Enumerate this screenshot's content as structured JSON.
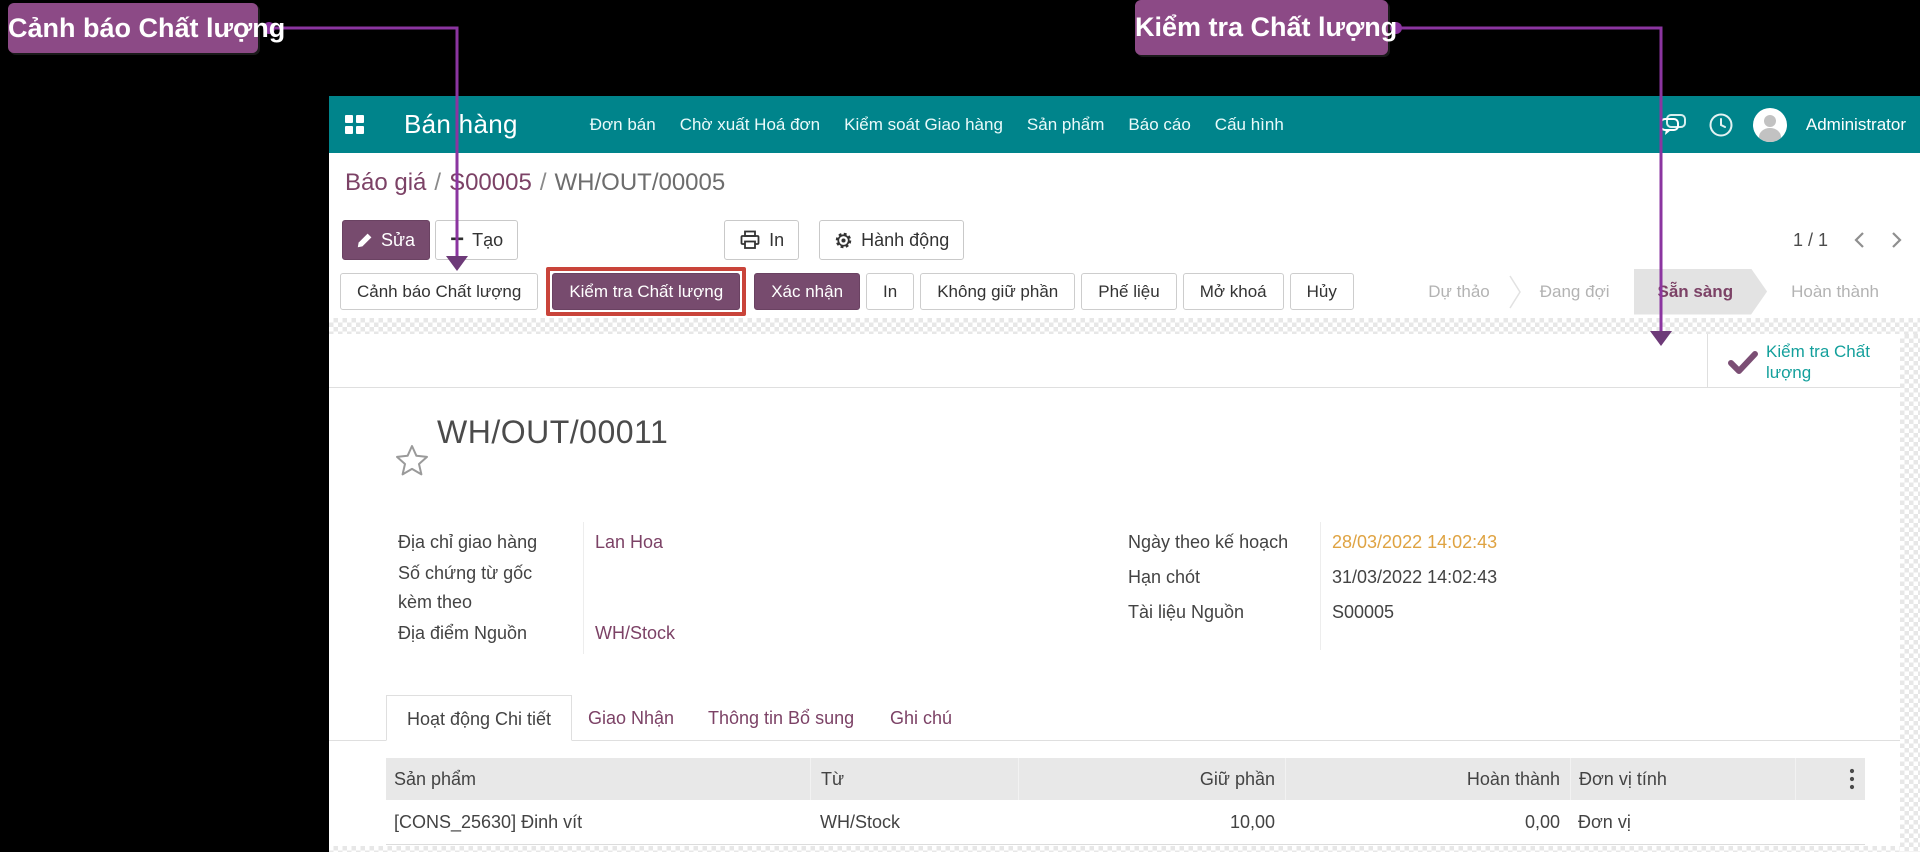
{
  "annotations": {
    "left_callout": "Cảnh báo Chất lượng",
    "right_callout": "Kiểm tra Chất lượng"
  },
  "navbar": {
    "app_title": "Bán hàng",
    "menu": {
      "orders": "Đơn bán",
      "to_invoice": "Chờ xuất Hoá đơn",
      "delivery_control": "Kiểm soát Giao hàng",
      "products": "Sản phẩm",
      "reporting": "Báo cáo",
      "config": "Cấu hình"
    },
    "user_name": "Administrator"
  },
  "breadcrumb": {
    "link1": "Báo giá",
    "link2": "S00005",
    "current": "WH/OUT/00005",
    "separator": "/"
  },
  "control_bar": {
    "edit": "Sửa",
    "create": "Tạo",
    "print": "In",
    "action": "Hành động",
    "pager": "1 / 1"
  },
  "action_bar": {
    "quality_alert": "Cảnh báo Chất lượng",
    "quality_check": "Kiểm tra Chất lượng",
    "confirm": "Xác nhận",
    "print": "In",
    "unreserve": "Không giữ phần",
    "scrap": "Phế liệu",
    "unlock": "Mở khoá",
    "cancel": "Hủy"
  },
  "statusbar": {
    "draft": "Dự thảo",
    "waiting": "Đang đợi",
    "ready": "Sẵn sàng",
    "done": "Hoàn thành"
  },
  "form": {
    "smart_button": "Kiểm tra Chất lượng",
    "title": "WH/OUT/00011",
    "fields": {
      "delivery_address_label": "Địa chỉ giao hàng",
      "delivery_address_value": "Lan Hoa",
      "original_docs_label": "Số chứng từ gốc kèm theo",
      "source_location_label": "Địa điểm Nguồn",
      "source_location_value": "WH/Stock",
      "scheduled_date_label": "Ngày theo kế hoạch",
      "scheduled_date_value": "28/03/2022 14:02:43",
      "deadline_label": "Hạn chót",
      "deadline_value": "31/03/2022 14:02:43",
      "source_document_label": "Tài liệu Nguồn",
      "source_document_value": "S00005"
    },
    "tabs": {
      "operations": "Hoạt động Chi tiết",
      "delivery": "Giao Nhận",
      "additional_info": "Thông tin Bổ sung",
      "notes": "Ghi chú"
    },
    "table": {
      "headers": {
        "product": "Sản phẩm",
        "from": "Từ",
        "reserved": "Giữ phần",
        "done": "Hoàn thành",
        "uom": "Đơn vị tính"
      },
      "row": {
        "product": "[CONS_25630] Đinh vít",
        "from": "WH/Stock",
        "reserved": "10,00",
        "done": "0,00",
        "uom": "Đơn vị"
      }
    }
  },
  "icons": {
    "apps": "grid-icon",
    "messages": "chat-icon",
    "activities": "clock-icon",
    "user": "avatar",
    "edit": "pencil-icon",
    "create": "plus-icon",
    "print": "printer-icon",
    "action": "gear-icon",
    "favorite": "star-icon",
    "quality_check": "check-icon",
    "row_options": "kebab-icon"
  },
  "colors": {
    "navbar_teal": "#00848b",
    "primary_purple": "#774b6e",
    "annotation_purple": "#8c4a86",
    "arrow_purple": "#8b35a0",
    "highlight_red": "#c9443a",
    "link_purple": "#7c4266",
    "date_orange": "#dfa342",
    "smart_button_teal": "#14a09c"
  }
}
